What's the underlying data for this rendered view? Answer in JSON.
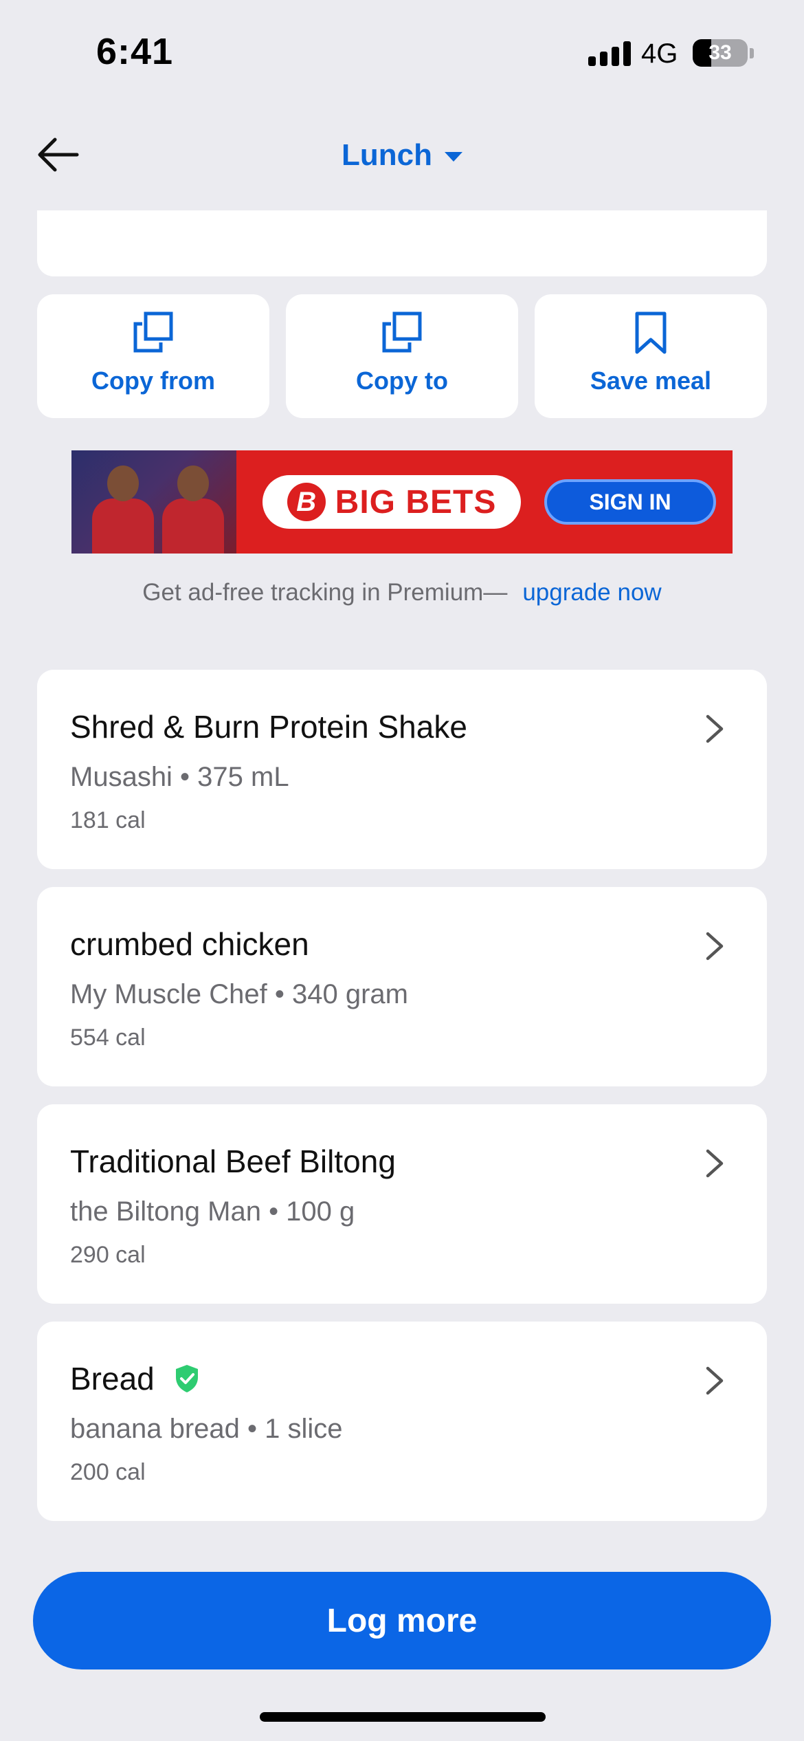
{
  "status_bar": {
    "time": "6:41",
    "network": "4G",
    "battery": "33"
  },
  "nav": {
    "title": "Lunch",
    "back_icon": "arrow-left-icon",
    "dropdown_icon": "caret-down-icon"
  },
  "actions": [
    {
      "label": "Copy from",
      "icon": "copy-icon"
    },
    {
      "label": "Copy to",
      "icon": "copy-icon"
    },
    {
      "label": "Save meal",
      "icon": "bookmark-icon"
    }
  ],
  "ad": {
    "brand": "BIG BETS",
    "logo_mark": "B",
    "cta": "SIGN IN"
  },
  "premium": {
    "text": "Get ad-free tracking in Premium—",
    "link": "upgrade now"
  },
  "foods": [
    {
      "name": "Shred & Burn Protein Shake",
      "detail": "Musashi • 375 mL",
      "calories": "181 cal",
      "verified": false
    },
    {
      "name": "crumbed chicken",
      "detail": "My Muscle Chef • 340 gram",
      "calories": "554 cal",
      "verified": false
    },
    {
      "name": "Traditional Beef Biltong",
      "detail": "the Biltong Man • 100 g",
      "calories": "290 cal",
      "verified": false
    },
    {
      "name": "Bread",
      "detail": "banana bread • 1 slice",
      "calories": "200 cal",
      "verified": true
    }
  ],
  "log_more_label": "Log more",
  "colors": {
    "accent": "#0b66d6",
    "button": "#0b66e6",
    "background": "#ebebf0",
    "verified": "#2ecc71",
    "ad_red": "#dc1f1f"
  }
}
